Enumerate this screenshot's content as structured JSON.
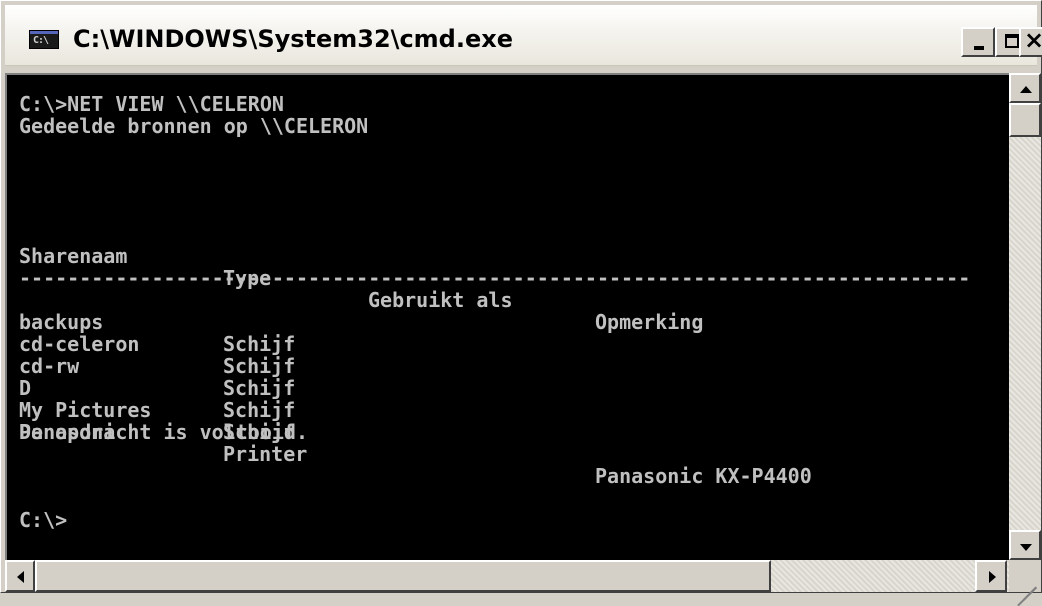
{
  "window": {
    "title": "C:\\WINDOWS\\System32\\cmd.exe",
    "icon_label": "C:\\"
  },
  "console": {
    "lines": [
      "C:\\>NET VIEW \\\\CELERON",
      "Gedeelde bronnen op \\\\CELERON",
      "-------------------------------------------------------------------------------",
      "De opdracht is voltooid.",
      "C:\\>"
    ],
    "headers": [
      "Sharenaam",
      "Type",
      "Gebruikt als",
      "Opmerking"
    ],
    "rows": [
      {
        "name": "backups",
        "type": "Schijf",
        "used_as": "",
        "remark": ""
      },
      {
        "name": "cd-celeron",
        "type": "Schijf",
        "used_as": "",
        "remark": ""
      },
      {
        "name": "cd-rw",
        "type": "Schijf",
        "used_as": "",
        "remark": ""
      },
      {
        "name": "D",
        "type": "Schijf",
        "used_as": "",
        "remark": ""
      },
      {
        "name": "My Pictures",
        "type": "Schijf",
        "used_as": "",
        "remark": ""
      },
      {
        "name": "Panasoni",
        "type": "Printer",
        "used_as": "",
        "remark": "Panasonic KX-P4400"
      }
    ]
  },
  "colors": {
    "console_background": "#000000",
    "console_text": "#c0c0c0",
    "window_face": "#d4d0c8"
  },
  "icons": [
    "console-icon",
    "minimize-icon",
    "maximize-icon",
    "close-icon",
    "scroll-up-icon",
    "scroll-down-icon",
    "scroll-left-icon",
    "scroll-right-icon",
    "resize-grip-icon"
  ]
}
